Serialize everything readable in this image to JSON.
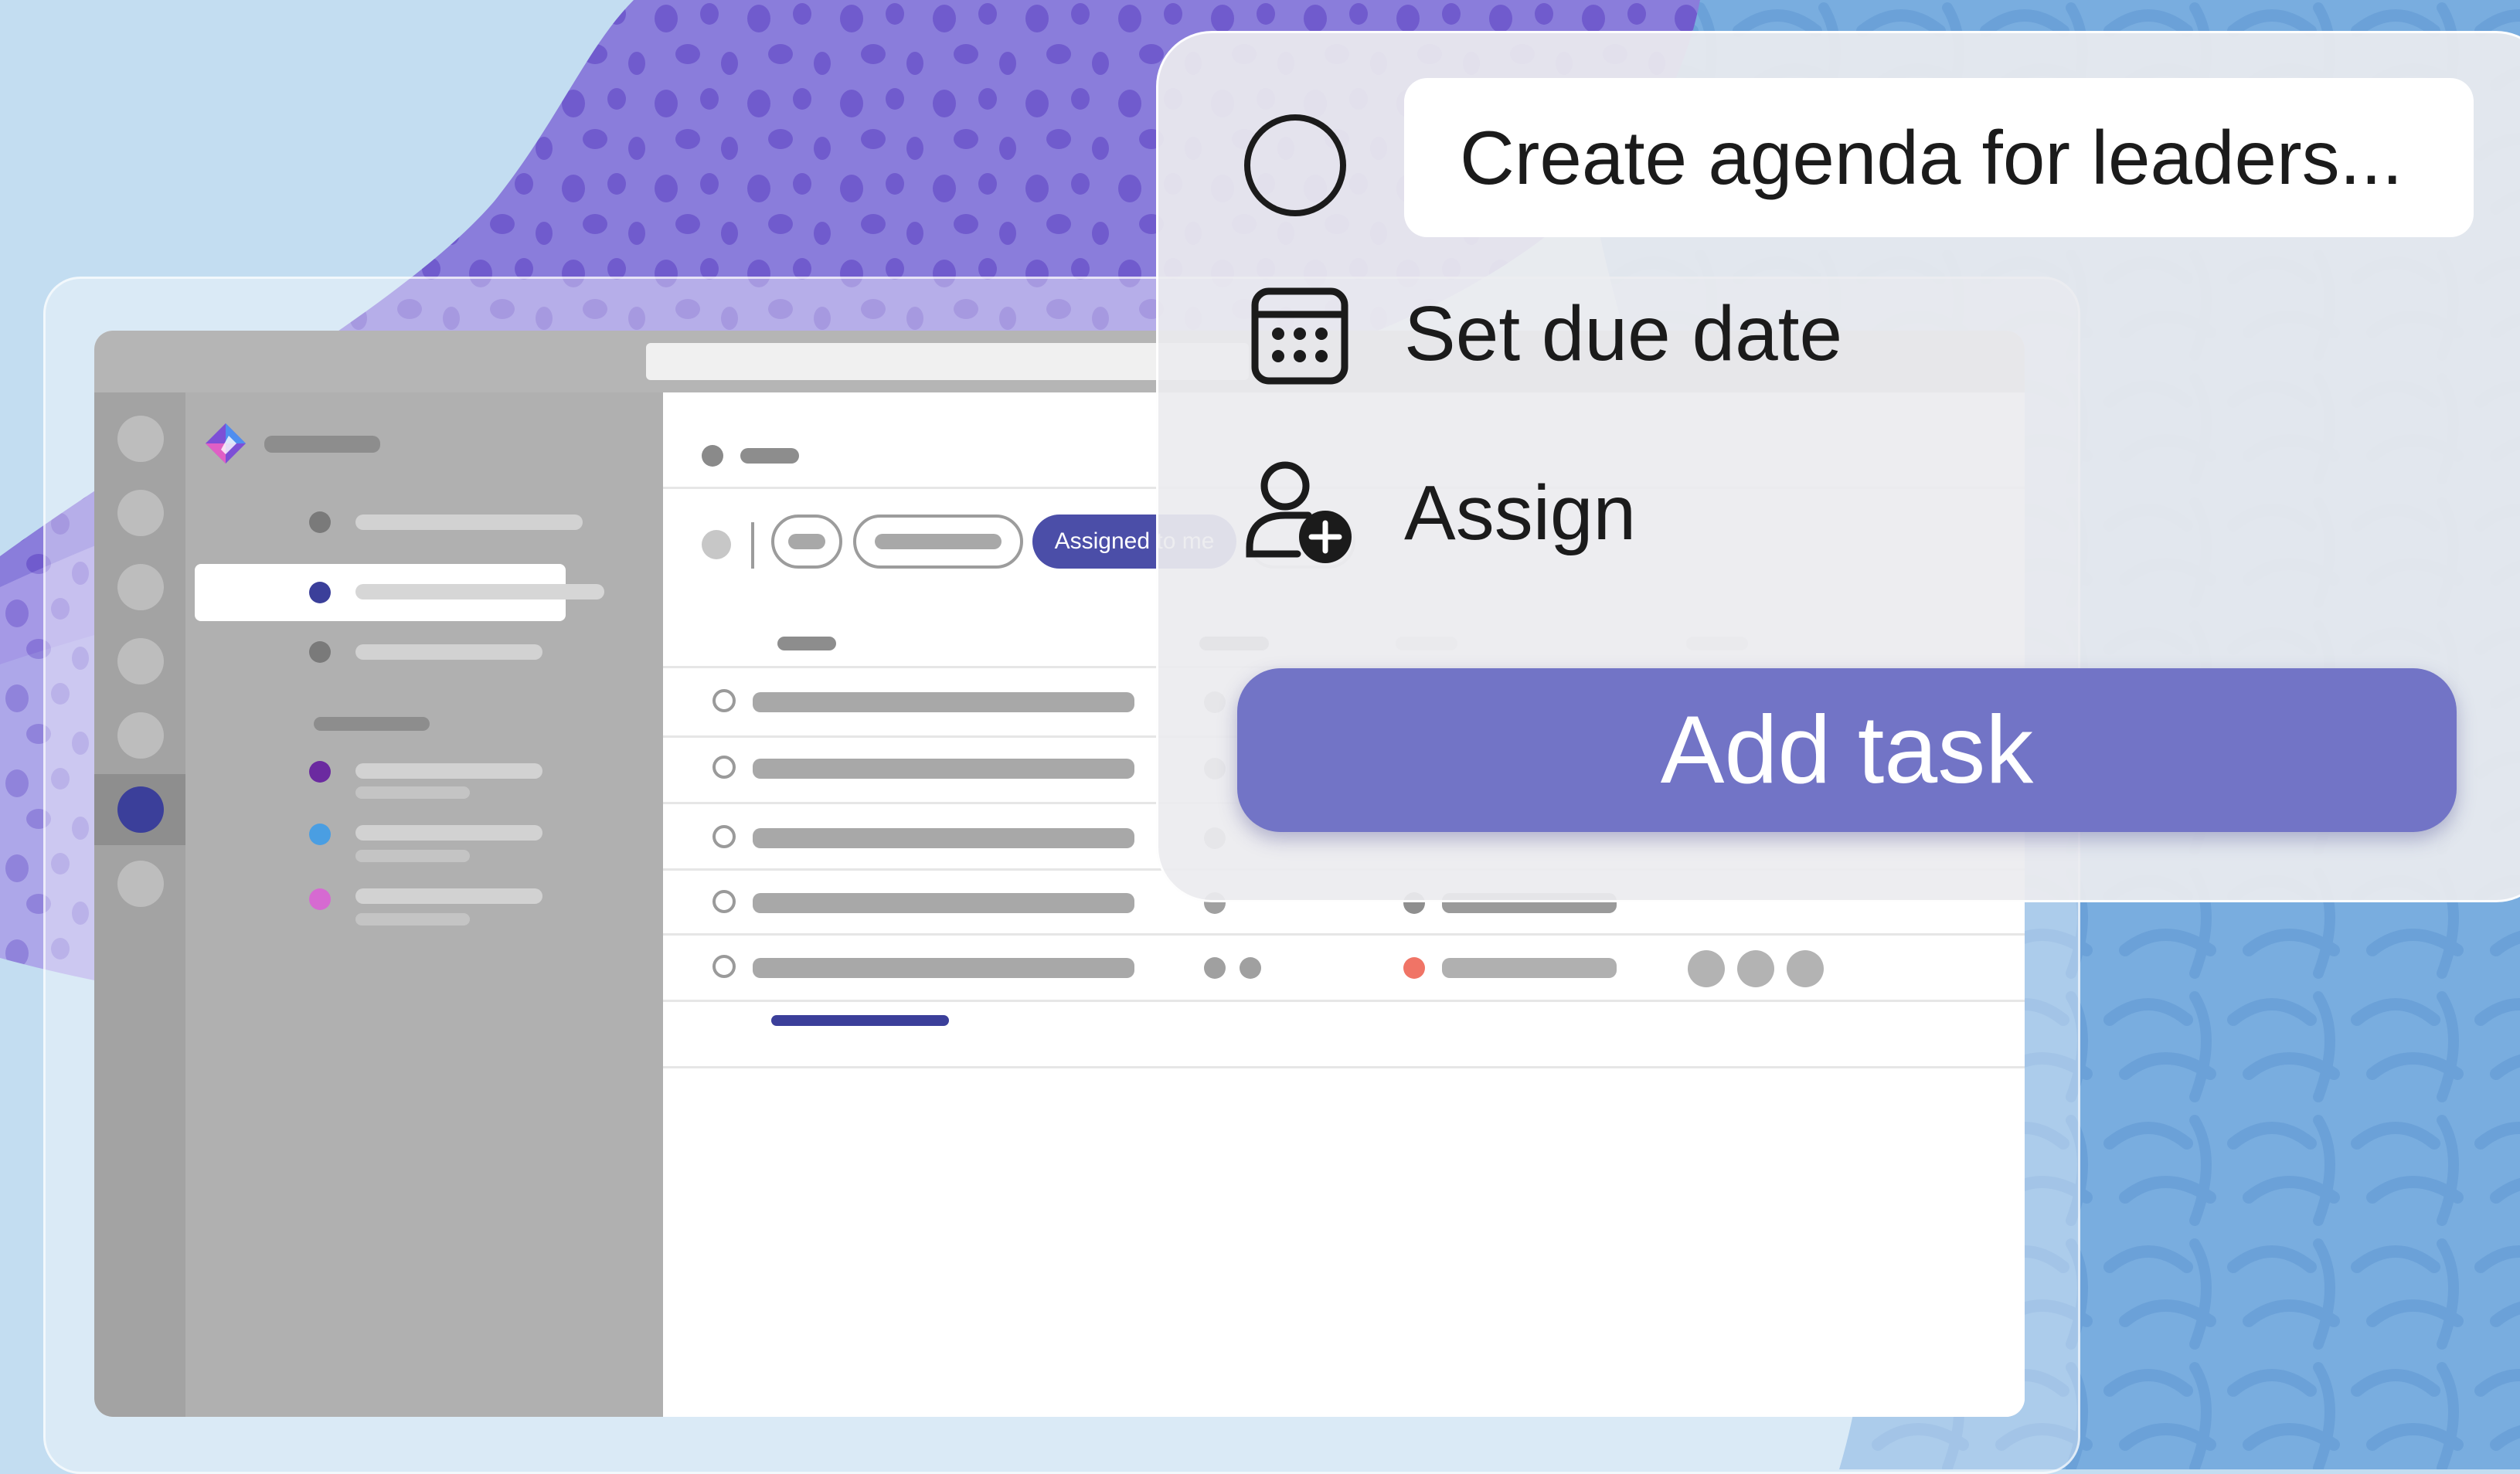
{
  "colors": {
    "background": "#c3ddf1",
    "blob_purple": "#8a7ddb",
    "blob_purple_light": "#a99de8",
    "blob_blue": "#79addf",
    "accent": "#4b4ea8",
    "add_button": "#7274c6"
  },
  "app": {
    "filter_chip_label": "Assigned to me",
    "sidebar_list_colors": [
      "#6b2aa0",
      "#4a9ee2",
      "#d66ad1"
    ],
    "last_row_status_color": "#f07466"
  },
  "quick_add": {
    "task_title_value": "Create agenda for leaders...",
    "due_date_label": "Set due date",
    "assign_label": "Assign",
    "add_button_label": "Add task",
    "icons": {
      "complete": "circle-icon",
      "due_date": "calendar-icon",
      "assign": "person-add-icon"
    }
  }
}
